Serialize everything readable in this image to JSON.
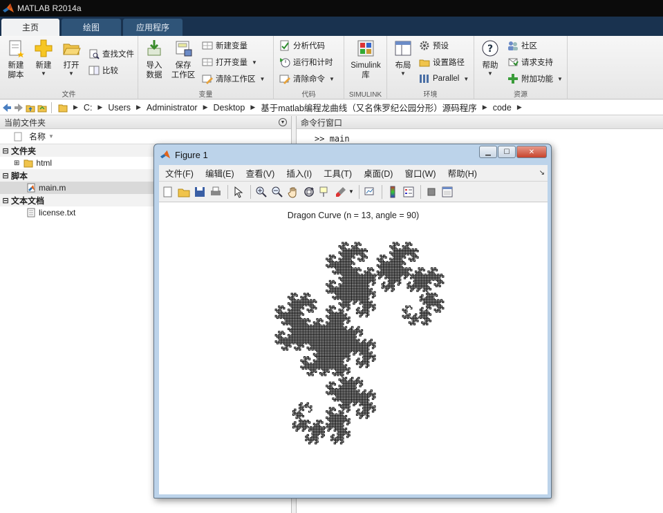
{
  "app": {
    "title": "MATLAB R2014a"
  },
  "tabs": [
    {
      "label": "主页"
    },
    {
      "label": "绘图"
    },
    {
      "label": "应用程序"
    }
  ],
  "ribbon": {
    "file": {
      "label": "文件",
      "new_script": "新建\n脚本",
      "new": "新建",
      "open": "打开",
      "find_files": "查找文件",
      "compare": "比较"
    },
    "variable": {
      "label": "变量",
      "import": "导入\n数据",
      "save_workspace": "保存\n工作区",
      "new_variable": "新建变量",
      "open_variable": "打开变量",
      "clear_workspace": "清除工作区"
    },
    "code": {
      "label": "代码",
      "analyze": "分析代码",
      "run_time": "运行和计时",
      "clear_commands": "清除命令"
    },
    "simulink": {
      "label": "SIMULINK",
      "library": "Simulink\n库"
    },
    "environment": {
      "label": "环境",
      "layout": "布局",
      "preferences": "预设",
      "set_path": "设置路径",
      "parallel": "Parallel"
    },
    "resources": {
      "label": "资源",
      "help": "帮助",
      "community": "社区",
      "support": "请求支持",
      "addons": "附加功能"
    }
  },
  "address": {
    "crumbs": [
      "C:",
      "Users",
      "Administrator",
      "Desktop",
      "基于matlab编程龙曲线（又名侏罗纪公园分形）源码程序",
      "code"
    ]
  },
  "file_panel": {
    "title": "当前文件夹",
    "column": "名称",
    "groups": [
      {
        "label": "文件夹",
        "items": [
          {
            "name": "html",
            "icon": "folder-icon"
          }
        ]
      },
      {
        "label": "脚本",
        "items": [
          {
            "name": "main.m",
            "icon": "m-file-icon",
            "selected": true
          }
        ]
      },
      {
        "label": "文本文档",
        "items": [
          {
            "name": "license.txt",
            "icon": "text-file-icon"
          }
        ]
      }
    ]
  },
  "command_window": {
    "title": "命令行窗口",
    "prompt": ">>",
    "command": "main"
  },
  "figure": {
    "title": "Figure 1",
    "menu": [
      "文件(F)",
      "编辑(E)",
      "查看(V)",
      "插入(I)",
      "工具(T)",
      "桌面(D)",
      "窗口(W)",
      "帮助(H)"
    ],
    "chart_title": "Dragon Curve (n = 13, angle = 90)"
  },
  "chart_data": {
    "type": "line",
    "title": "Dragon Curve (n = 13, angle = 90)",
    "iterations": 13,
    "angle": 90,
    "grid": false,
    "axis": "off",
    "color": "#000000"
  },
  "colors": {
    "accent": "#19324f",
    "tab": "#2f5478",
    "figure_frame": "#bcd3ea"
  }
}
